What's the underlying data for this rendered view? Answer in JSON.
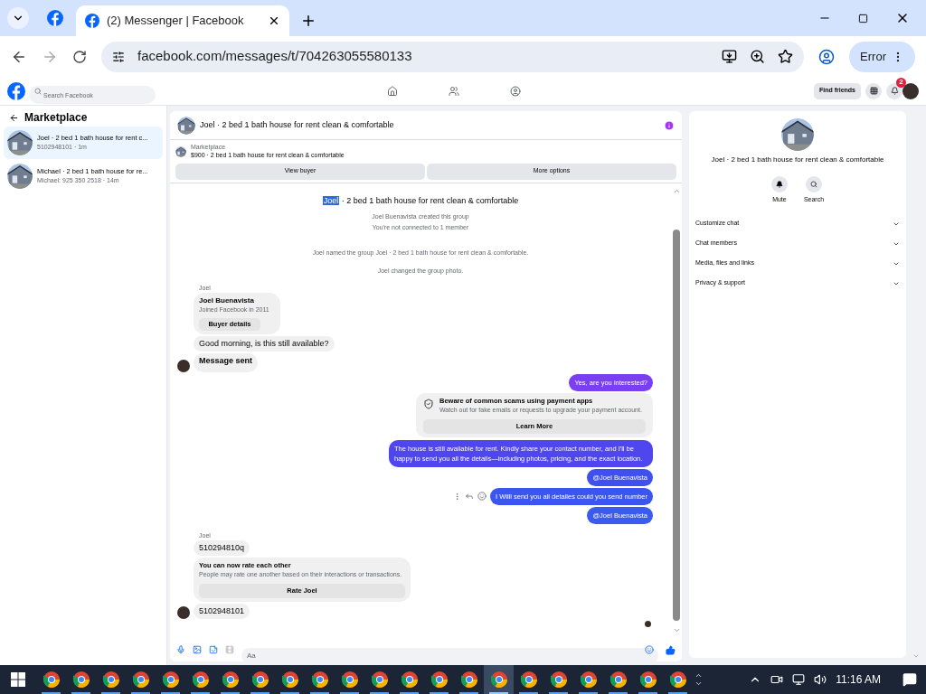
{
  "browser": {
    "tab_title": "(2) Messenger | Facebook",
    "url": "facebook.com/messages/t/704263055580133",
    "profile_button": "Error"
  },
  "topbar": {
    "search_placeholder": "Search Facebook",
    "find_friends": "Find friends",
    "notification_count": "2"
  },
  "sidebar": {
    "title": "Marketplace",
    "items": [
      {
        "title": "Joel · 2 bed 1 bath house for rent c...",
        "subtitle": "5102948101 · 1m",
        "selected": true
      },
      {
        "title": "Michael · 2 bed 1 bath house for re...",
        "subtitle": "Michael: 925 350 2518 · 14m",
        "selected": false
      }
    ]
  },
  "chat": {
    "title": "Joel · 2 bed 1 bath house for rent clean & comfortable",
    "listing": {
      "source": "Marketplace",
      "summary": "$900 · 2 bed 1 bath house for rent clean & comfortable"
    },
    "buttons": [
      "View buyer",
      "More options"
    ],
    "intro": {
      "highlight": "Joel",
      "title": " · 2 bed 1 bath house for rent clean & comfortable",
      "lines": [
        "Joel Buenavista created this group",
        "You're not connected to 1 member"
      ]
    },
    "messages": [
      {
        "kind": "system",
        "text": "Joel named the group Joel · 2 bed 1 bath house for rent clean & comfortable."
      },
      {
        "kind": "system",
        "text": "Joel changed the group photo."
      },
      {
        "kind": "sender",
        "text": "Joel"
      },
      {
        "kind": "profile",
        "name": "Joel Buenavista",
        "detail": "Joined Facebook in 2011",
        "button": "Buyer details"
      },
      {
        "kind": "incoming",
        "text": "Good morning, is this still available?",
        "avatar": false,
        "bold": false
      },
      {
        "kind": "incoming",
        "text": "Message sent",
        "avatar": true,
        "bold": true
      },
      {
        "kind": "outgoing",
        "text": "Yes, are you interested?",
        "color": "#7b3ff2",
        "actions": false
      },
      {
        "kind": "warning",
        "title": "Beware of common scams using payment apps",
        "detail": "Watch out for fake emails or requests to upgrade your payment account.",
        "button": "Learn More"
      },
      {
        "kind": "outgoing",
        "text": "The house is still available for rent. Kindly share your contact number, and I'll be happy to send you all the details—including photos, pricing, and the exact location.",
        "color": "#4f46f0",
        "actions": false
      },
      {
        "kind": "outgoing",
        "text": "@Joel Buenavista",
        "color": "#3f4ff0",
        "actions": false
      },
      {
        "kind": "outgoing",
        "text": "I Willl send you all detailes could you send number",
        "color": "#3b55f0",
        "actions": true
      },
      {
        "kind": "outgoing",
        "text": "@Joel Buenavista",
        "color": "#3a5af0",
        "actions": false
      },
      {
        "kind": "sender",
        "text": "Joel"
      },
      {
        "kind": "incoming",
        "text": "510294810q",
        "avatar": false,
        "bold": false
      },
      {
        "kind": "rating",
        "title": "You can now rate each other",
        "detail": "People may rate one another based on their interactions or transactions.",
        "button": "Rate Joel"
      },
      {
        "kind": "incoming",
        "text": "5102948101",
        "avatar": true,
        "bold": false
      }
    ],
    "composer_placeholder": "Aa"
  },
  "details": {
    "title": "Joel · 2 bed 1 bath house for rent clean & comfortable",
    "actions": [
      "Mute",
      "Search"
    ],
    "sections": [
      "Customize chat",
      "Chat members",
      "Media, files and links",
      "Privacy & support"
    ]
  },
  "taskbar": {
    "apps": [
      {
        "selected": false
      },
      {
        "selected": false
      },
      {
        "selected": false
      },
      {
        "selected": false
      },
      {
        "selected": false
      },
      {
        "selected": false
      },
      {
        "selected": false
      },
      {
        "selected": false
      },
      {
        "selected": false
      },
      {
        "selected": false
      },
      {
        "selected": false
      },
      {
        "selected": false
      },
      {
        "selected": false
      },
      {
        "selected": false
      },
      {
        "selected": false
      },
      {
        "selected": true
      },
      {
        "selected": false
      },
      {
        "selected": false
      },
      {
        "selected": false
      },
      {
        "selected": false
      },
      {
        "selected": false
      },
      {
        "selected": false
      }
    ],
    "clock": "11:16 AM"
  }
}
